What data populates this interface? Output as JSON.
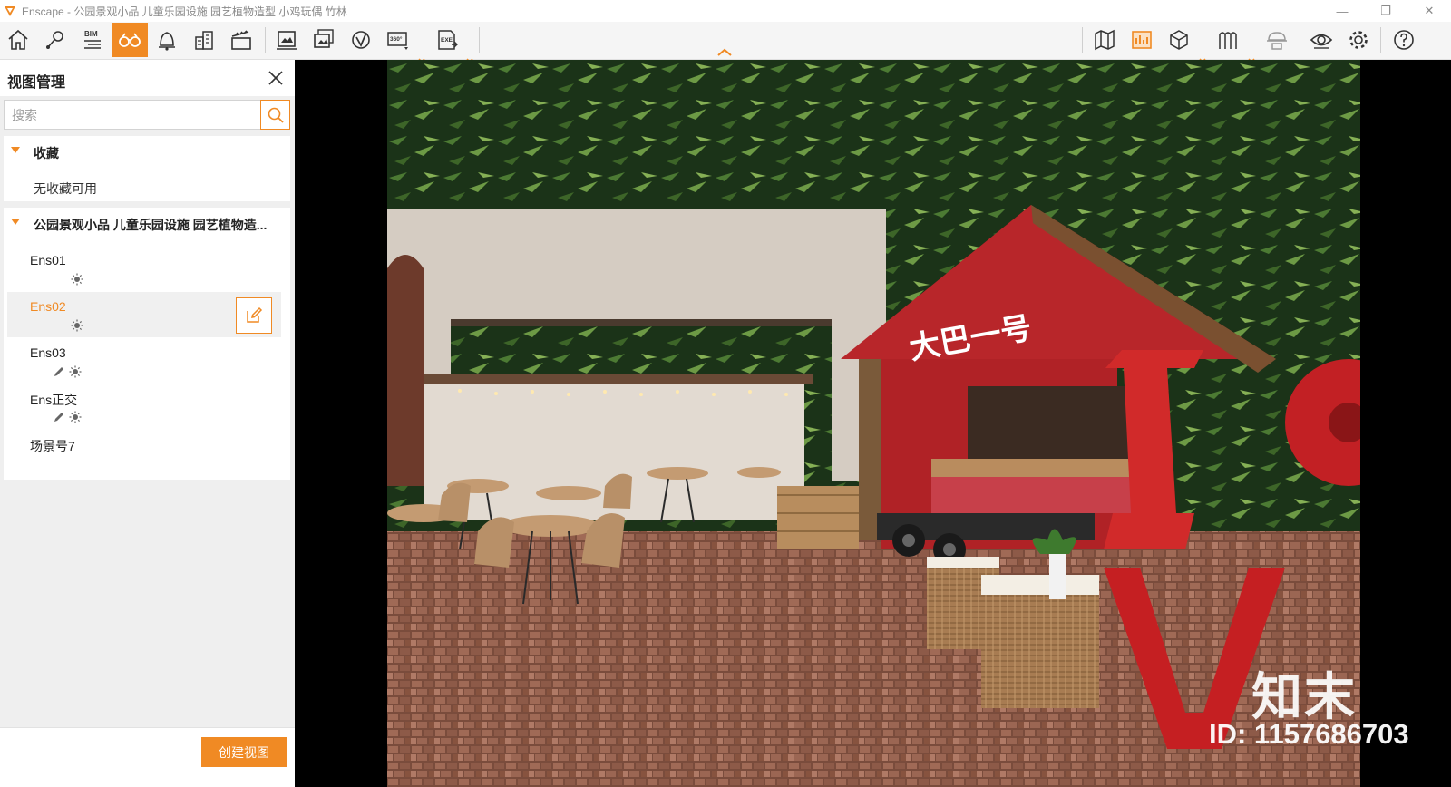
{
  "window": {
    "title": "Enscape - 公园景观小品 儿童乐园设施 园艺植物造型 小鸡玩偶 竹林",
    "minimize": "—",
    "restore": "❐",
    "close": "✕"
  },
  "toolbar": {
    "buttons": [
      "home",
      "location",
      "bim",
      "views",
      "bell",
      "buildings",
      "video",
      "screenshot",
      "batch-render",
      "panorama",
      "360",
      "exe-export",
      "map",
      "render-settings",
      "cube",
      "library",
      "hat",
      "eye",
      "gear",
      "help"
    ],
    "bim_label": "BIM",
    "pano_label": "360°",
    "exe_label": "EXE",
    "active": "views",
    "accent": "#f08a24"
  },
  "sidebar": {
    "title": "视图管理",
    "search_placeholder": "搜索",
    "favorites": {
      "title": "收藏",
      "empty_text": "无收藏可用"
    },
    "project": {
      "title": "公园景观小品 儿童乐园设施 园艺植物造...",
      "views": [
        {
          "name": "Ens01",
          "icons": [
            "sun"
          ]
        },
        {
          "name": "Ens02",
          "icons": [
            "sun"
          ],
          "selected": true
        },
        {
          "name": "Ens03",
          "icons": [
            "pencil",
            "sun"
          ]
        },
        {
          "name": "Ens正交",
          "icons": [
            "pencil",
            "sun"
          ]
        },
        {
          "name": "场景号7",
          "icons": []
        }
      ]
    },
    "create_button": "创建视图"
  },
  "viewport": {
    "scene_sign": "大巴一号",
    "watermark_logo": "知末",
    "watermark_id": "ID: 1157686703"
  }
}
